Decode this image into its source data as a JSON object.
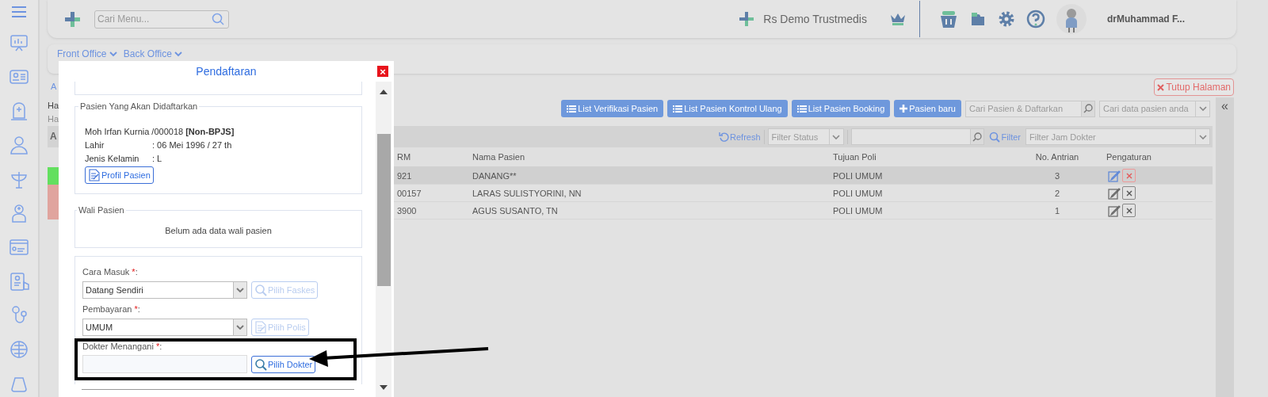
{
  "topbar": {
    "search": {
      "placeholder": "Cari Menu..."
    },
    "hospital": "Rs Demo Trustmedis",
    "user": "drMuhammad F..."
  },
  "breadcrumbs": [
    {
      "label": "Front Office"
    },
    {
      "label": "Back Office"
    }
  ],
  "left_edge_texts": [
    "A",
    "Ha",
    "Ha",
    "A"
  ],
  "close_page_button": "Tutup Halaman",
  "toolbar": {
    "buttons": [
      "List Verifikasi Pasien",
      "List Pasien Kontrol Ulang",
      "List Pasien Booking"
    ],
    "new_button": "Pasien baru",
    "patient_search": {
      "placeholder": "Cari Pasien & Daftarkan"
    },
    "data_search": {
      "placeholder": "Cari data pasien anda"
    },
    "collapse": "«"
  },
  "filter_bar": {
    "refresh": "Refresh",
    "status": {
      "placeholder": "Filter Status"
    },
    "filter_label": "Filter",
    "doctor_time": {
      "placeholder": "Filter Jam Dokter"
    }
  },
  "table": {
    "columns": [
      "RM",
      "Nama Pasien",
      "Tujuan Poli",
      "No. Antrian",
      "Pengaturan"
    ],
    "rows": [
      {
        "rm": "921",
        "name": "DANANG**",
        "poli": "POLI UMUM",
        "queue": "3",
        "selected": true,
        "color": "#63df5f"
      },
      {
        "rm": "00157",
        "name": "LARAS SULISTYORINI, NN",
        "poli": "POLI UMUM",
        "queue": "2",
        "selected": false,
        "color": "#e0a49e"
      },
      {
        "rm": "3900",
        "name": "AGUS SUSANTO, TN",
        "poli": "POLI UMUM",
        "queue": "1",
        "selected": false,
        "color": "#e0a49e"
      }
    ]
  },
  "modal": {
    "title": "Pendaftaran",
    "close": "×",
    "patient": {
      "legend": "Pasien Yang Akan Didaftarkan",
      "name_line": "Moh Irfan Kurnia /000018 **[Non-BPJS]**",
      "fields": [
        {
          "label": "Lahir",
          "value": ": 06 Mei 1996 / 27 th"
        },
        {
          "label": "Jenis Kelamin",
          "value": ": L"
        }
      ],
      "profile_button": "Profil Pasien"
    },
    "guardian": {
      "legend": "Wali Pasien",
      "empty_text": "Belum ada data wali pasien"
    },
    "form": [
      {
        "label": "Cara Masuk ",
        "required_mark": "*",
        "label_end": ":",
        "kind": "select",
        "value": "Datang Sendiri",
        "button": "Pilih Faskes",
        "button_disabled": true
      },
      {
        "label": "Pembayaran ",
        "required_mark": "*",
        "label_end": ":",
        "kind": "select",
        "value": "UMUM",
        "button": "Pilih Polis",
        "button_disabled": true
      },
      {
        "label": "Dokter Menangani ",
        "required_mark": "*",
        "label_end": ":",
        "kind": "input",
        "button": "Pilih Dokter",
        "button_disabled": false
      }
    ]
  }
}
